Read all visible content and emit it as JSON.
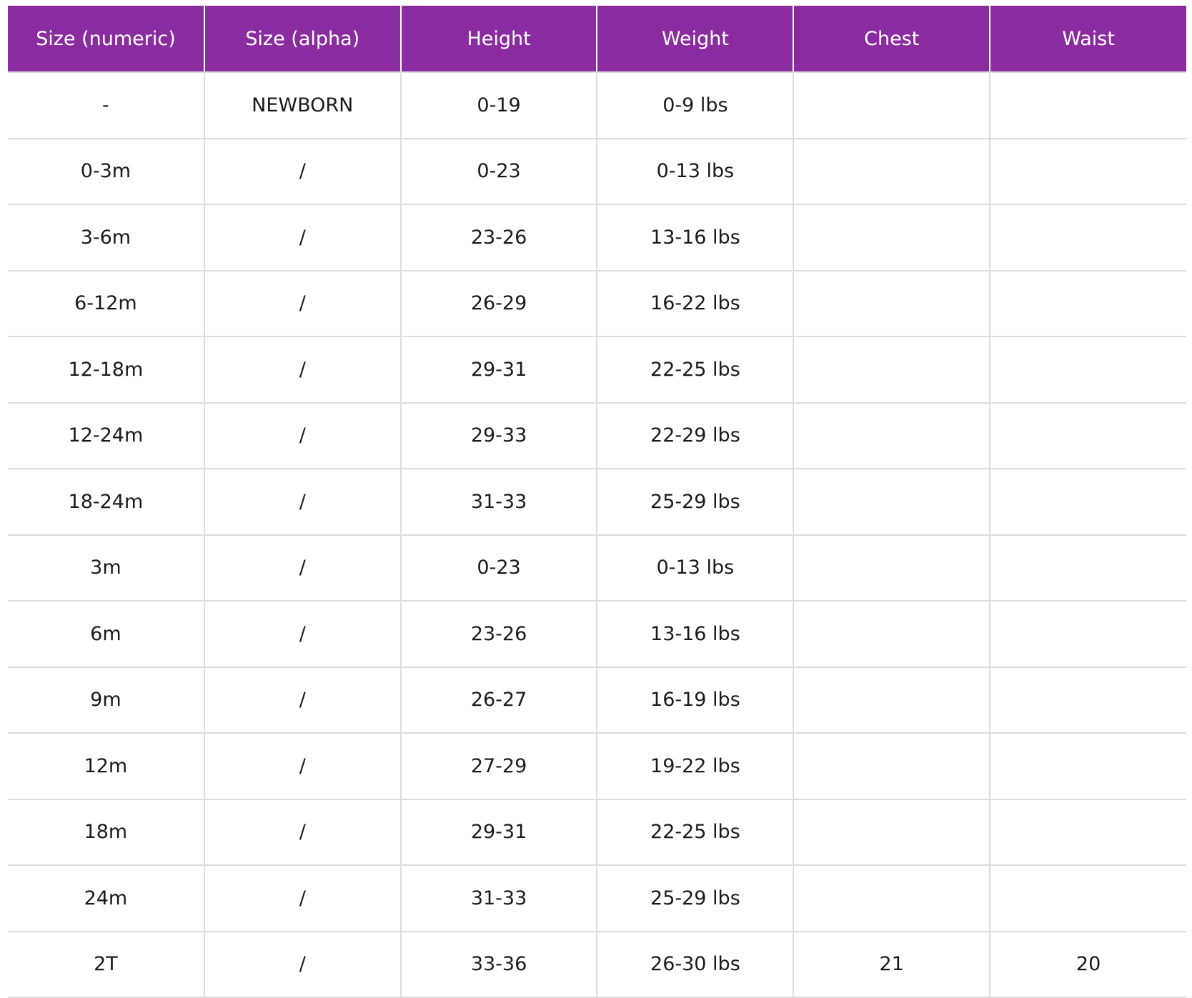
{
  "table": {
    "columns": [
      "Size (numeric)",
      "Size (alpha)",
      "Height",
      "Weight",
      "Chest",
      "Waist"
    ],
    "rows": [
      [
        "-",
        "NEWBORN",
        "0-19",
        "0-9 lbs",
        "",
        ""
      ],
      [
        "0-3m",
        "/",
        "0-23",
        "0-13 lbs",
        "",
        ""
      ],
      [
        "3-6m",
        "/",
        "23-26",
        "13-16 lbs",
        "",
        ""
      ],
      [
        "6-12m",
        "/",
        "26-29",
        "16-22 lbs",
        "",
        ""
      ],
      [
        "12-18m",
        "/",
        "29-31",
        "22-25 lbs",
        "",
        ""
      ],
      [
        "12-24m",
        "/",
        "29-33",
        "22-29 lbs",
        "",
        ""
      ],
      [
        "18-24m",
        "/",
        "31-33",
        "25-29 lbs",
        "",
        ""
      ],
      [
        "3m",
        "/",
        "0-23",
        "0-13 lbs",
        "",
        ""
      ],
      [
        "6m",
        "/",
        "23-26",
        "13-16 lbs",
        "",
        ""
      ],
      [
        "9m",
        "/",
        "26-27",
        "16-19 lbs",
        "",
        ""
      ],
      [
        "12m",
        "/",
        "27-29",
        "19-22 lbs",
        "",
        ""
      ],
      [
        "18m",
        "/",
        "29-31",
        "22-25 lbs",
        "",
        ""
      ],
      [
        "24m",
        "/",
        "31-33",
        "25-29 lbs",
        "",
        ""
      ],
      [
        "2T",
        "/",
        "33-36",
        "26-30 lbs",
        "21",
        "20"
      ]
    ]
  },
  "colors": {
    "header_bg": "#8a2ba0",
    "header_text": "#ffffff",
    "grid": "#dcdcdc",
    "cell_text": "#1a1a1a"
  }
}
